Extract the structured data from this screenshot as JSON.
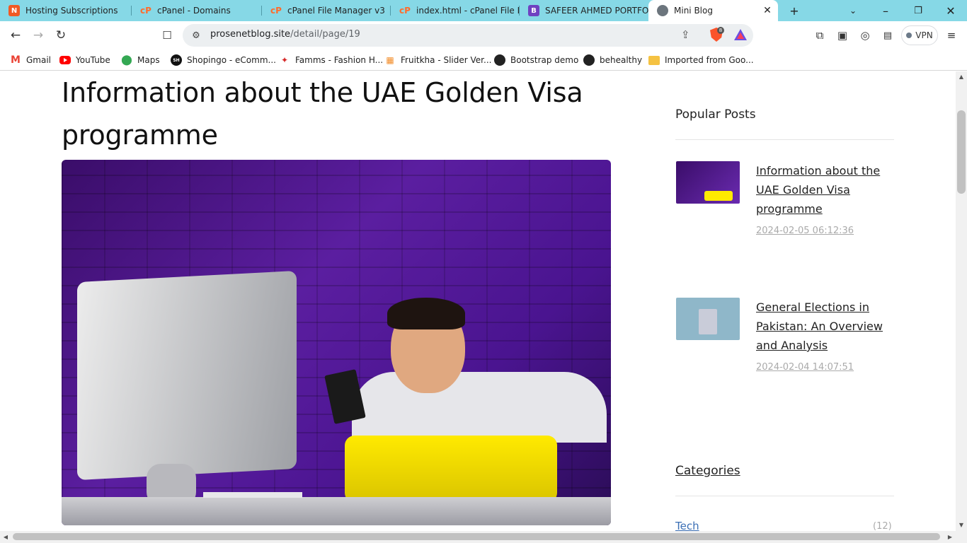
{
  "tabs": [
    {
      "title": "Hosting Subscriptions",
      "favicon": "hosting-icon"
    },
    {
      "title": "cPanel - Domains",
      "favicon": "cpanel-icon"
    },
    {
      "title": "cPanel File Manager v3",
      "favicon": "cpanel-icon"
    },
    {
      "title": "index.html - cPanel File Ma",
      "favicon": "cpanel-icon"
    },
    {
      "title": "SAFEER AHMED PORTFOLIO",
      "favicon": "bootstrap-icon"
    },
    {
      "title": "Mini Blog",
      "favicon": "globe-icon",
      "active": true
    }
  ],
  "toolbar": {
    "url_host": "prosenetblog.site",
    "url_path": "/detail/page/19",
    "brave_shield_count": "8",
    "vpn_label": "VPN"
  },
  "bookmarks": [
    {
      "label": "Gmail"
    },
    {
      "label": "YouTube"
    },
    {
      "label": "Maps"
    },
    {
      "label": "Shopingo - eComm..."
    },
    {
      "label": "Famms - Fashion H..."
    },
    {
      "label": "Fruitkha - Slider Ver..."
    },
    {
      "label": "Bootstrap demo"
    },
    {
      "label": "behealthy"
    },
    {
      "label": "Imported from Goo..."
    }
  ],
  "post": {
    "title": "Information about the UAE Golden Visa programme"
  },
  "sidebar": {
    "popular_heading": "Popular Posts",
    "popular_posts": [
      {
        "title": "Information about the UAE Golden Visa programme",
        "date": "2024-02-05 06:12:36"
      },
      {
        "title": "General Elections in Pakistan: An Overview and Analysis",
        "date": "2024-02-04 14:07:51"
      }
    ],
    "categories_heading": "Categories",
    "categories": [
      {
        "name": "Tech",
        "count": "(12)"
      }
    ]
  },
  "colors": {
    "tabstrip": "#86d8e6",
    "link_blue": "#3b6fb5",
    "date_gray": "#aaaaaa"
  }
}
